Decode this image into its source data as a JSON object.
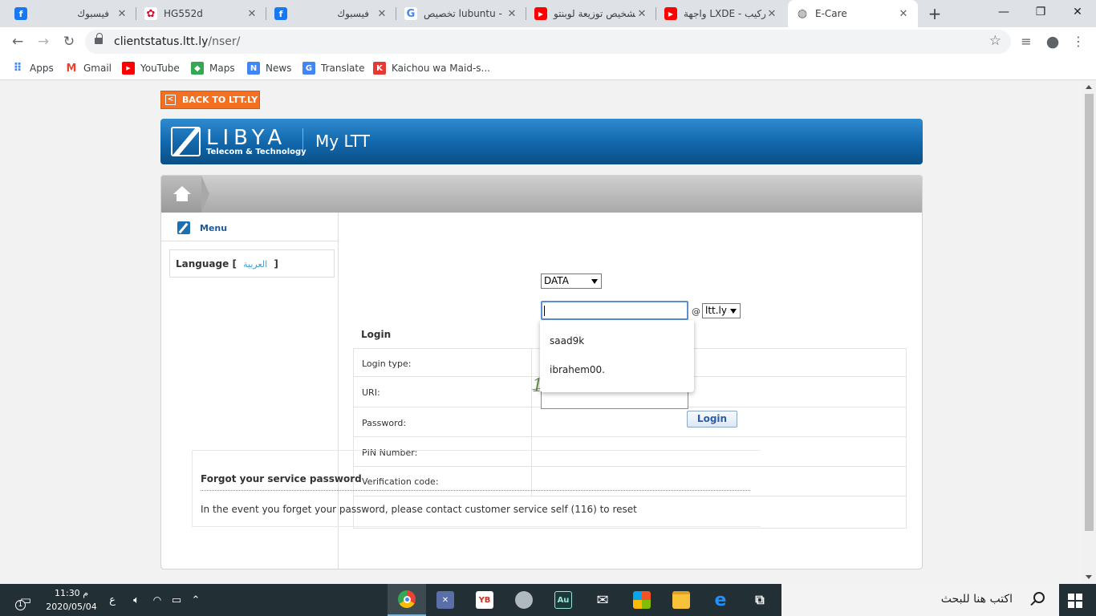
{
  "browser": {
    "tabs": [
      {
        "title": "فيسبوك",
        "icon": "facebook-icon",
        "color": "#1877f2",
        "glyph": "f"
      },
      {
        "title": "HG552d",
        "icon": "huawei-icon",
        "color": "#cf0a2c",
        "glyph": "✿"
      },
      {
        "title": "فيسبوك",
        "icon": "facebook-icon",
        "color": "#1877f2",
        "glyph": "f"
      },
      {
        "title": "تخصيص lubuntu -",
        "icon": "google-icon",
        "color": "#ffffff",
        "glyph": "G"
      },
      {
        "title": "تشخيص توزيعة لوبنتو",
        "icon": "youtube-icon",
        "color": "#ff0000",
        "glyph": "▶"
      },
      {
        "title": "واجهة LXDE - التركيب",
        "icon": "youtube-icon",
        "color": "#ff0000",
        "glyph": "▶"
      },
      {
        "title": "E-Care",
        "icon": "globe-icon",
        "color": "#5f6368",
        "glyph": "◍"
      }
    ],
    "url_host": "clientstatus.ltt.ly",
    "url_path": "/nser/",
    "bookmarks": [
      {
        "label": "Apps",
        "icon": "apps-grid-icon",
        "color": "#4285f4",
        "glyph": "⠿"
      },
      {
        "label": "Gmail",
        "icon": "gmail-icon",
        "color": "#ea4335",
        "glyph": "M"
      },
      {
        "label": "YouTube",
        "icon": "youtube-icon",
        "color": "#ff0000",
        "glyph": "▶"
      },
      {
        "label": "Maps",
        "icon": "maps-icon",
        "color": "#34a853",
        "glyph": "◆"
      },
      {
        "label": "News",
        "icon": "news-icon",
        "color": "#4285f4",
        "glyph": "N"
      },
      {
        "label": "Translate",
        "icon": "translate-icon",
        "color": "#4285f4",
        "glyph": "G"
      },
      {
        "label": "Kaichou wa Maid-s...",
        "icon": "k-bookmark-icon",
        "color": "#e53935",
        "glyph": "K"
      }
    ]
  },
  "page": {
    "back_label": "BACK TO LTT.LY",
    "brand": "LIBYA",
    "tagline": "Telecom & Technology",
    "portal": "My LTT",
    "menu_label": "Menu",
    "language_label": "Language",
    "language_bracket_open": "[",
    "language_option": "العربية",
    "language_bracket_close": "]",
    "login": {
      "title": "Login",
      "fields": [
        {
          "label": "Login type:"
        },
        {
          "label": "URI:"
        },
        {
          "label": "Password:"
        },
        {
          "label": "PIN Number:"
        },
        {
          "label": "Verification code:"
        }
      ],
      "login_type_value": "DATA",
      "uri_value": "",
      "at_sign": "@",
      "domain_value": "ltt.ly",
      "captcha_text": "1627",
      "button": "Login",
      "autocomplete": [
        "saad9k",
        "ibrahem00."
      ]
    },
    "forgot": {
      "title": "Forgot your service password",
      "text": "In the event you forget your password, please contact customer service self (116) to reset"
    }
  },
  "taskbar": {
    "time": "11:30 م",
    "date": "2020/05/04",
    "lang": "ع",
    "notify_count": "1",
    "search_placeholder": "اكتب هنا للبحث",
    "apps": [
      {
        "icon": "chrome-icon",
        "label": ""
      },
      {
        "icon": "app-icon",
        "label": ""
      },
      {
        "icon": "yb-app-icon",
        "label": "YB"
      },
      {
        "icon": "app-icon-2",
        "label": ""
      },
      {
        "icon": "audition-icon",
        "label": "Au"
      },
      {
        "icon": "mail-icon",
        "label": ""
      },
      {
        "icon": "store-icon",
        "label": ""
      },
      {
        "icon": "file-explorer-icon",
        "label": ""
      },
      {
        "icon": "edge-icon",
        "label": "e"
      },
      {
        "icon": "task-view-icon",
        "label": ""
      }
    ]
  }
}
